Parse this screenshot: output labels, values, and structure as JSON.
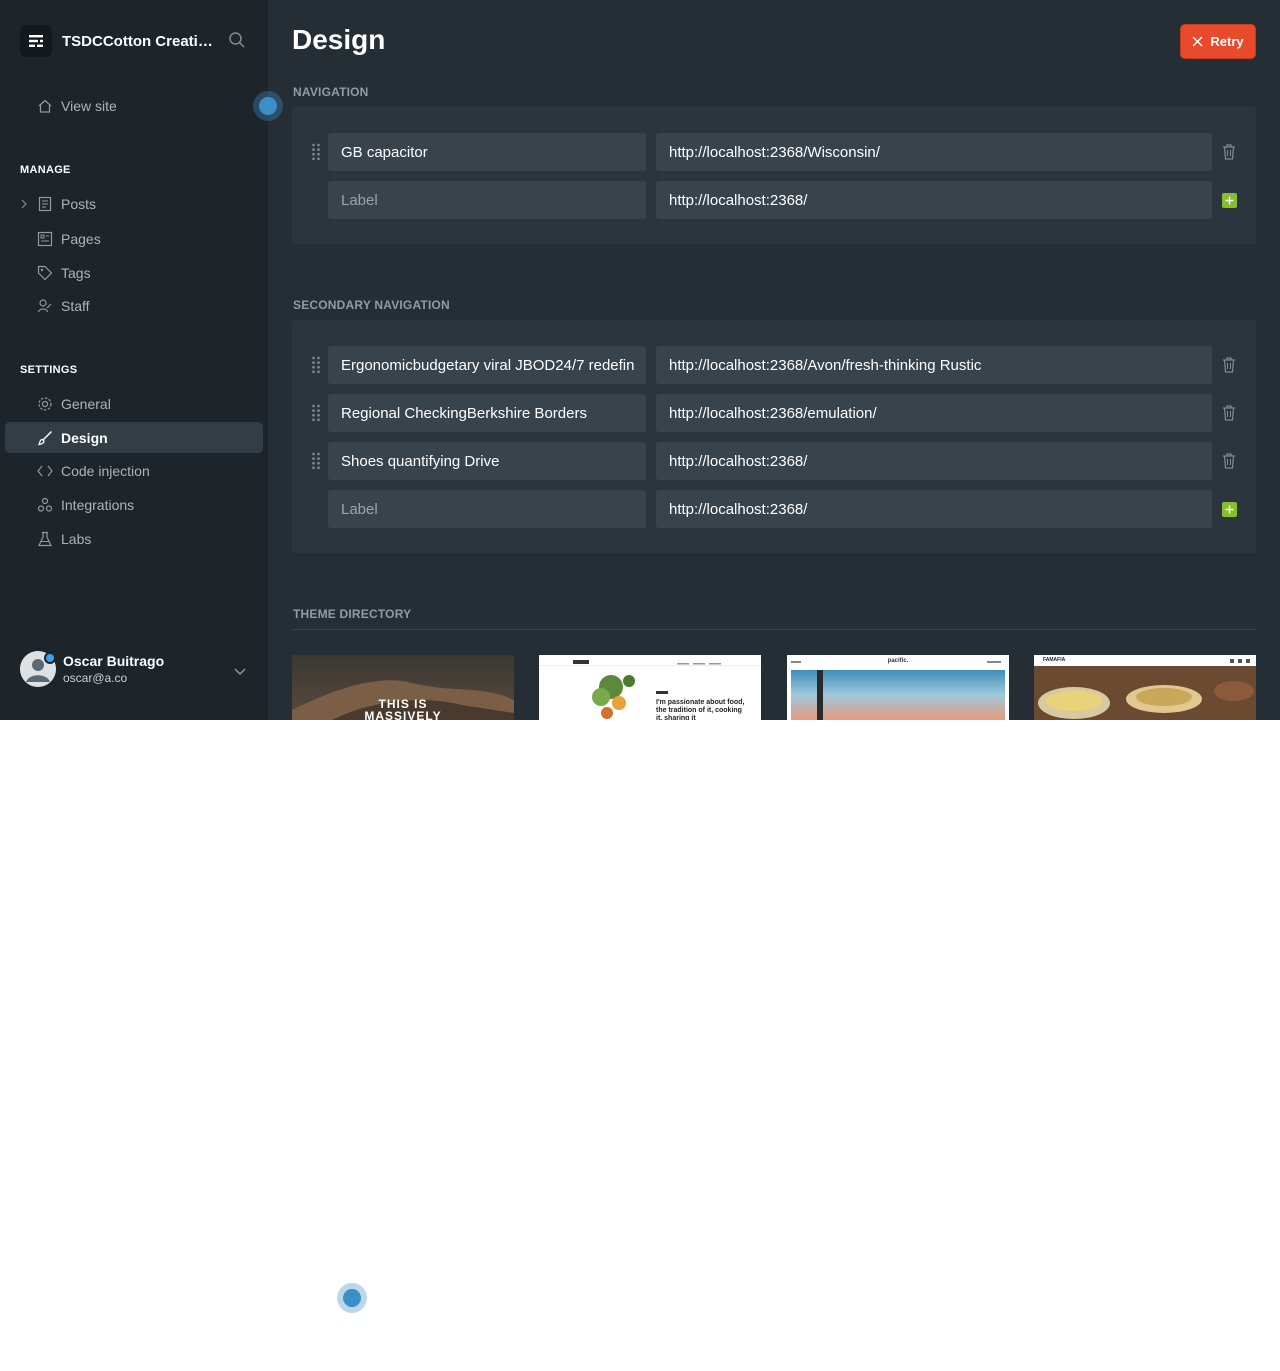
{
  "sidebar": {
    "site_title": "TSDCCotton Creative",
    "view_site": "View site",
    "manage_label": "MANAGE",
    "manage_items": [
      "Posts",
      "Pages",
      "Tags",
      "Staff"
    ],
    "settings_label": "SETTINGS",
    "settings_items": [
      "General",
      "Design",
      "Code injection",
      "Integrations",
      "Labs"
    ],
    "active_item": "Design",
    "user": {
      "name": "Oscar Buitrago",
      "email": "oscar@a.co"
    }
  },
  "header": {
    "title": "Design",
    "retry_label": "Retry"
  },
  "navigation": {
    "heading": "NAVIGATION",
    "items": [
      {
        "label": "GB capacitor",
        "url": "http://localhost:2368/Wisconsin/"
      }
    ],
    "new_item": {
      "label_placeholder": "Label",
      "url": "http://localhost:2368/"
    }
  },
  "secondary_navigation": {
    "heading": "SECONDARY NAVIGATION",
    "items": [
      {
        "label": "Ergonomicbudgetary viral JBOD24/7 redefin",
        "url": "http://localhost:2368/Avon/fresh-thinking Rustic"
      },
      {
        "label": "Regional CheckingBerkshire Borders",
        "url": "http://localhost:2368/emulation/"
      },
      {
        "label": "Shoes quantifying Drive",
        "url": "http://localhost:2368/"
      }
    ],
    "new_item": {
      "label_placeholder": "Label",
      "url": "http://localhost:2368/"
    }
  },
  "theme_directory": {
    "heading": "THEME DIRECTORY",
    "theme1_text": "THIS IS MASSIVELY",
    "theme2_text": "I'm passionate about food, the tradition of it, cooking it, sharing it",
    "theme3_logo": "pacific.",
    "theme4_logo": "FAMAFIA"
  },
  "colors": {
    "accent_red": "#e84a2c",
    "add_green": "#86bf2e",
    "sidebar_bg": "#1d252b",
    "main_bg": "#262e35"
  }
}
